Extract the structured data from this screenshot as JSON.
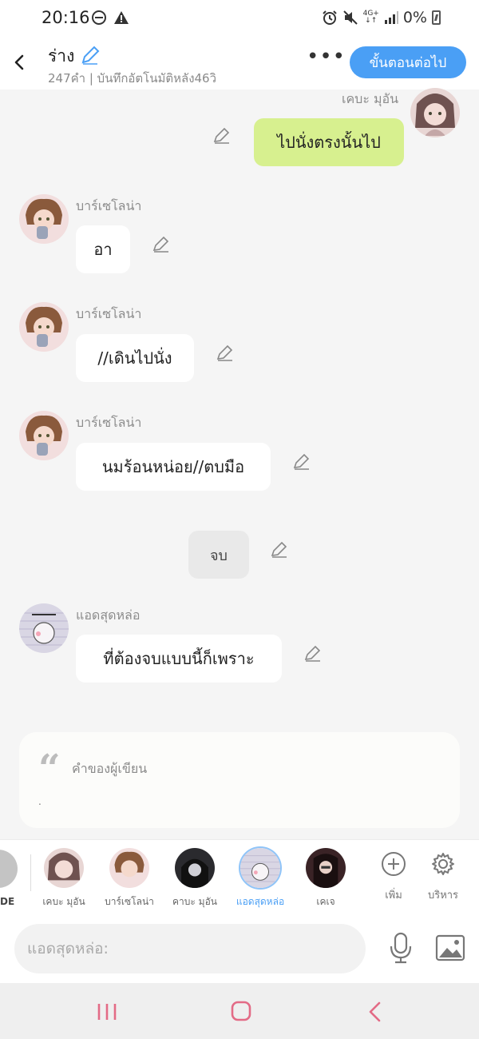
{
  "status": {
    "time": "20:16",
    "net_label": "4G+",
    "battery": "0%"
  },
  "header": {
    "title": "ร่าง",
    "subtitle": "247คำ | บันทึกอัตโนมัติหลัง46วิ",
    "more": "•••",
    "next_label": "ขั้นตอนต่อไป"
  },
  "chat": {
    "messages": [
      {
        "sender": "เคบะ มุอัน",
        "text": "ไปนั่งตรงนั้นไป",
        "side": "right"
      },
      {
        "sender": "บาร์เซโลน่า",
        "text": "อา",
        "side": "left"
      },
      {
        "sender": "บาร์เซโลน่า",
        "text": "//เดินไปนั่ง",
        "side": "left"
      },
      {
        "sender": "บาร์เซโลน่า",
        "text": "นมร้อนหน่อย//ตบมือ",
        "side": "left"
      },
      {
        "sender": "",
        "text": "จบ",
        "side": "narration"
      },
      {
        "sender": "แอดสุดหล่อ",
        "text": "ที่ต้องจบแบบนี้ก็เพราะ",
        "side": "left"
      }
    ],
    "author_note": {
      "label": "คำของผู้เขียน",
      "text": "."
    }
  },
  "characters": {
    "narration_label": "DE",
    "items": [
      {
        "name": "เคบะ มุอัน",
        "active": false
      },
      {
        "name": "บาร์เซโลน่า",
        "active": false
      },
      {
        "name": "คาบะ มุอัน",
        "active": false
      },
      {
        "name": "แอดสุดหล่อ",
        "active": true
      },
      {
        "name": "เคเจ",
        "active": false
      }
    ],
    "add_label": "เพิ่ม",
    "manage_label": "บริหาร"
  },
  "input": {
    "placeholder": "แอดสุดหล่อ:"
  },
  "colors": {
    "accent": "#4a9ff5",
    "my_bubble": "#d7f08f",
    "bubble": "#ffffff",
    "background": "#f5f5f5"
  }
}
